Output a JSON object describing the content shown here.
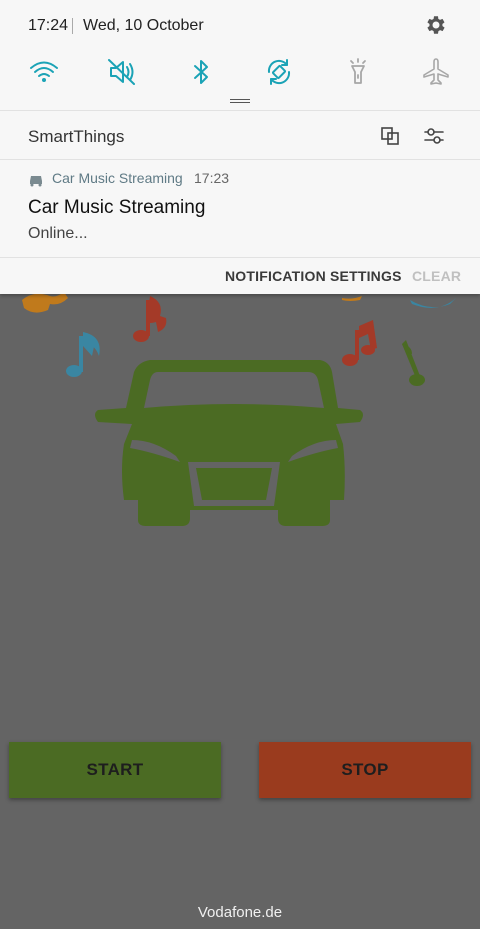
{
  "status_bar": {
    "time": "17:24",
    "date": "Wed, 10 October"
  },
  "quick_settings": {
    "accent_color": "#1ba3b6",
    "inactive_color": "#a7a7a7",
    "icons": [
      "wifi-icon",
      "sound-muted-icon",
      "bluetooth-icon",
      "auto-rotate-icon",
      "flashlight-icon",
      "airplane-mode-icon"
    ]
  },
  "panel": {
    "title": "SmartThings"
  },
  "notification": {
    "app_name": "Car Music Streaming",
    "time": "17:23",
    "title": "Car Music Streaming",
    "text": "Online..."
  },
  "notification_actions": {
    "settings_label": "NOTIFICATION SETTINGS",
    "clear_label": "CLEAR"
  },
  "app": {
    "start_label": "START",
    "stop_label": "STOP",
    "car_color": "#4b6b23",
    "start_color": "#4b6b23",
    "stop_color": "#9a3b1e"
  },
  "footer": {
    "carrier": "Vodafone.de"
  }
}
